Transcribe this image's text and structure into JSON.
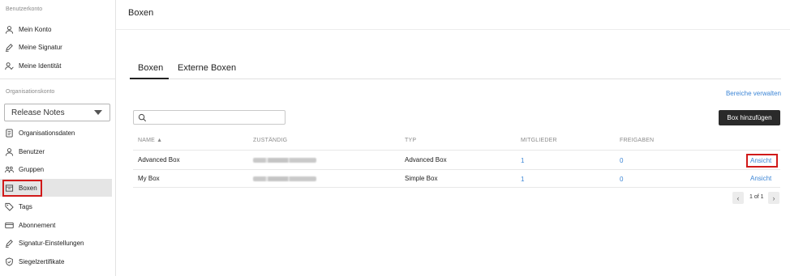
{
  "sidebar": {
    "user_section": "Benutzerkonto",
    "user_items": [
      {
        "label": "Mein Konto",
        "icon": "user-icon"
      },
      {
        "label": "Meine Signatur",
        "icon": "pen-icon"
      },
      {
        "label": "Meine Identität",
        "icon": "user-check-icon"
      }
    ],
    "org_section": "Organisationskonto",
    "org_select": "Release Notes",
    "org_items": [
      {
        "label": "Organisationsdaten",
        "icon": "document-icon"
      },
      {
        "label": "Benutzer",
        "icon": "user-icon"
      },
      {
        "label": "Gruppen",
        "icon": "users-icon"
      },
      {
        "label": "Boxen",
        "icon": "box-icon"
      },
      {
        "label": "Tags",
        "icon": "tag-icon"
      },
      {
        "label": "Abonnement",
        "icon": "credit-card-icon"
      },
      {
        "label": "Signatur-Einstellungen",
        "icon": "pen-icon"
      },
      {
        "label": "Siegelzertifikate",
        "icon": "shield-icon"
      }
    ]
  },
  "main": {
    "title": "Boxen",
    "tabs": [
      "Boxen",
      "Externe Boxen"
    ],
    "manage_link": "Bereiche verwalten",
    "add_button": "Box hinzufügen",
    "columns": [
      "NAME ▲",
      "ZUSTÄNDIG",
      "TYP",
      "MITGLIEDER",
      "FREIGABEN"
    ],
    "rows": [
      {
        "name": "Advanced Box",
        "type": "Advanced Box",
        "members": "1",
        "shares": "0",
        "action": "Ansicht"
      },
      {
        "name": "My Box",
        "type": "Simple Box",
        "members": "1",
        "shares": "0",
        "action": "Ansicht"
      }
    ],
    "pagination": "1 of 1"
  },
  "colors": {
    "accent_link": "#3d86d6",
    "highlight": "#d11a1a",
    "button_dark": "#2a2a2a"
  }
}
